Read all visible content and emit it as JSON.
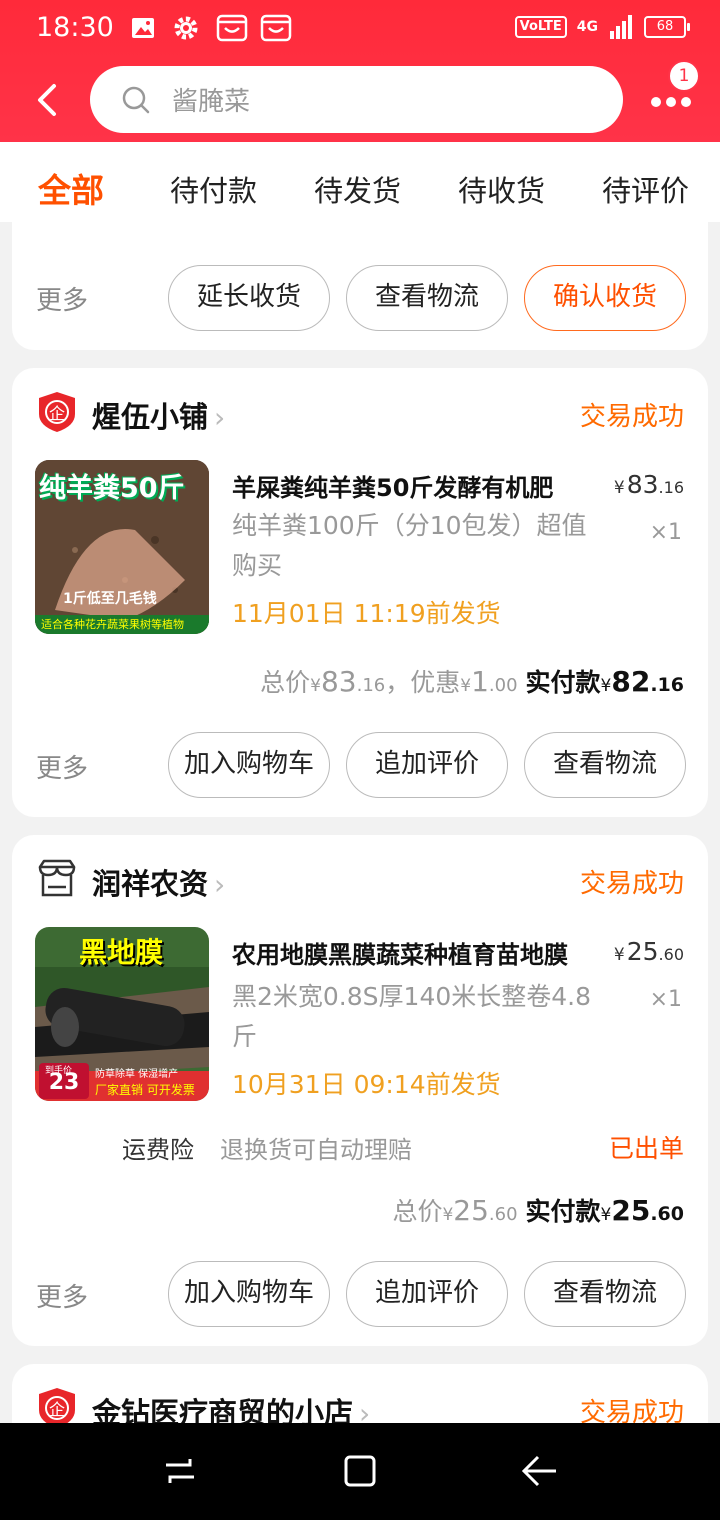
{
  "status_bar": {
    "time": "18:30",
    "volte": "VoLTE",
    "network": "4G",
    "battery": "68"
  },
  "search": {
    "placeholder": "酱腌菜",
    "more_badge": "1"
  },
  "tabs": [
    "全部",
    "待付款",
    "待发货",
    "待收货",
    "待评价"
  ],
  "partial_card": {
    "more": "更多",
    "buttons": [
      "延长收货",
      "查看物流",
      "确认收货"
    ]
  },
  "orders": [
    {
      "shop": "煋伍小铺",
      "status": "交易成功",
      "image_text": {
        "headline": "纯羊粪50斤",
        "sub": "1斤低至几毛钱",
        "bottom": "适合各种花卉蔬菜果树等植物"
      },
      "title": "羊屎粪纯羊粪50斤发酵有机肥",
      "spec": "纯羊粪100斤（分10包发）超值购买",
      "ship": "11月01日 11:19前发货",
      "price": {
        "yen": "¥",
        "int": "83",
        "dec": ".16"
      },
      "qty": "×1",
      "totals": {
        "total_label": "总价",
        "total_int": "83",
        "total_dec": ".16",
        "discount_label": "，优惠",
        "discount_int": "1",
        "discount_dec": ".00",
        "paid_label": "实付款",
        "paid_int": "82",
        "paid_dec": ".16"
      },
      "more": "更多",
      "buttons": [
        "加入购物车",
        "追加评价",
        "查看物流"
      ]
    },
    {
      "shop": "润祥农资",
      "status": "交易成功",
      "image_text": {
        "headline": "黑地膜",
        "sub": "防草除草 保湿增产",
        "bottom": "厂家直销 可开发票",
        "price_tag": "23",
        "price_tag_label": "到手价"
      },
      "title": "农用地膜黑膜蔬菜种植育苗地膜",
      "spec": "黑2米宽0.8S厚140米长整卷4.8斤",
      "ship": "10月31日 09:14前发货",
      "price": {
        "yen": "¥",
        "int": "25",
        "dec": ".60"
      },
      "qty": "×1",
      "insurance": {
        "label": "运费险",
        "desc": "退换货可自动理赔",
        "status": "已出单"
      },
      "totals": {
        "total_label": "总价",
        "total_int": "25",
        "total_dec": ".60",
        "paid_label": "实付款",
        "paid_int": "25",
        "paid_dec": ".60"
      },
      "more": "更多",
      "buttons": [
        "加入购物车",
        "追加评价",
        "查看物流"
      ]
    },
    {
      "shop": "金钻医疗商贸的小店",
      "status": "交易成功"
    }
  ]
}
